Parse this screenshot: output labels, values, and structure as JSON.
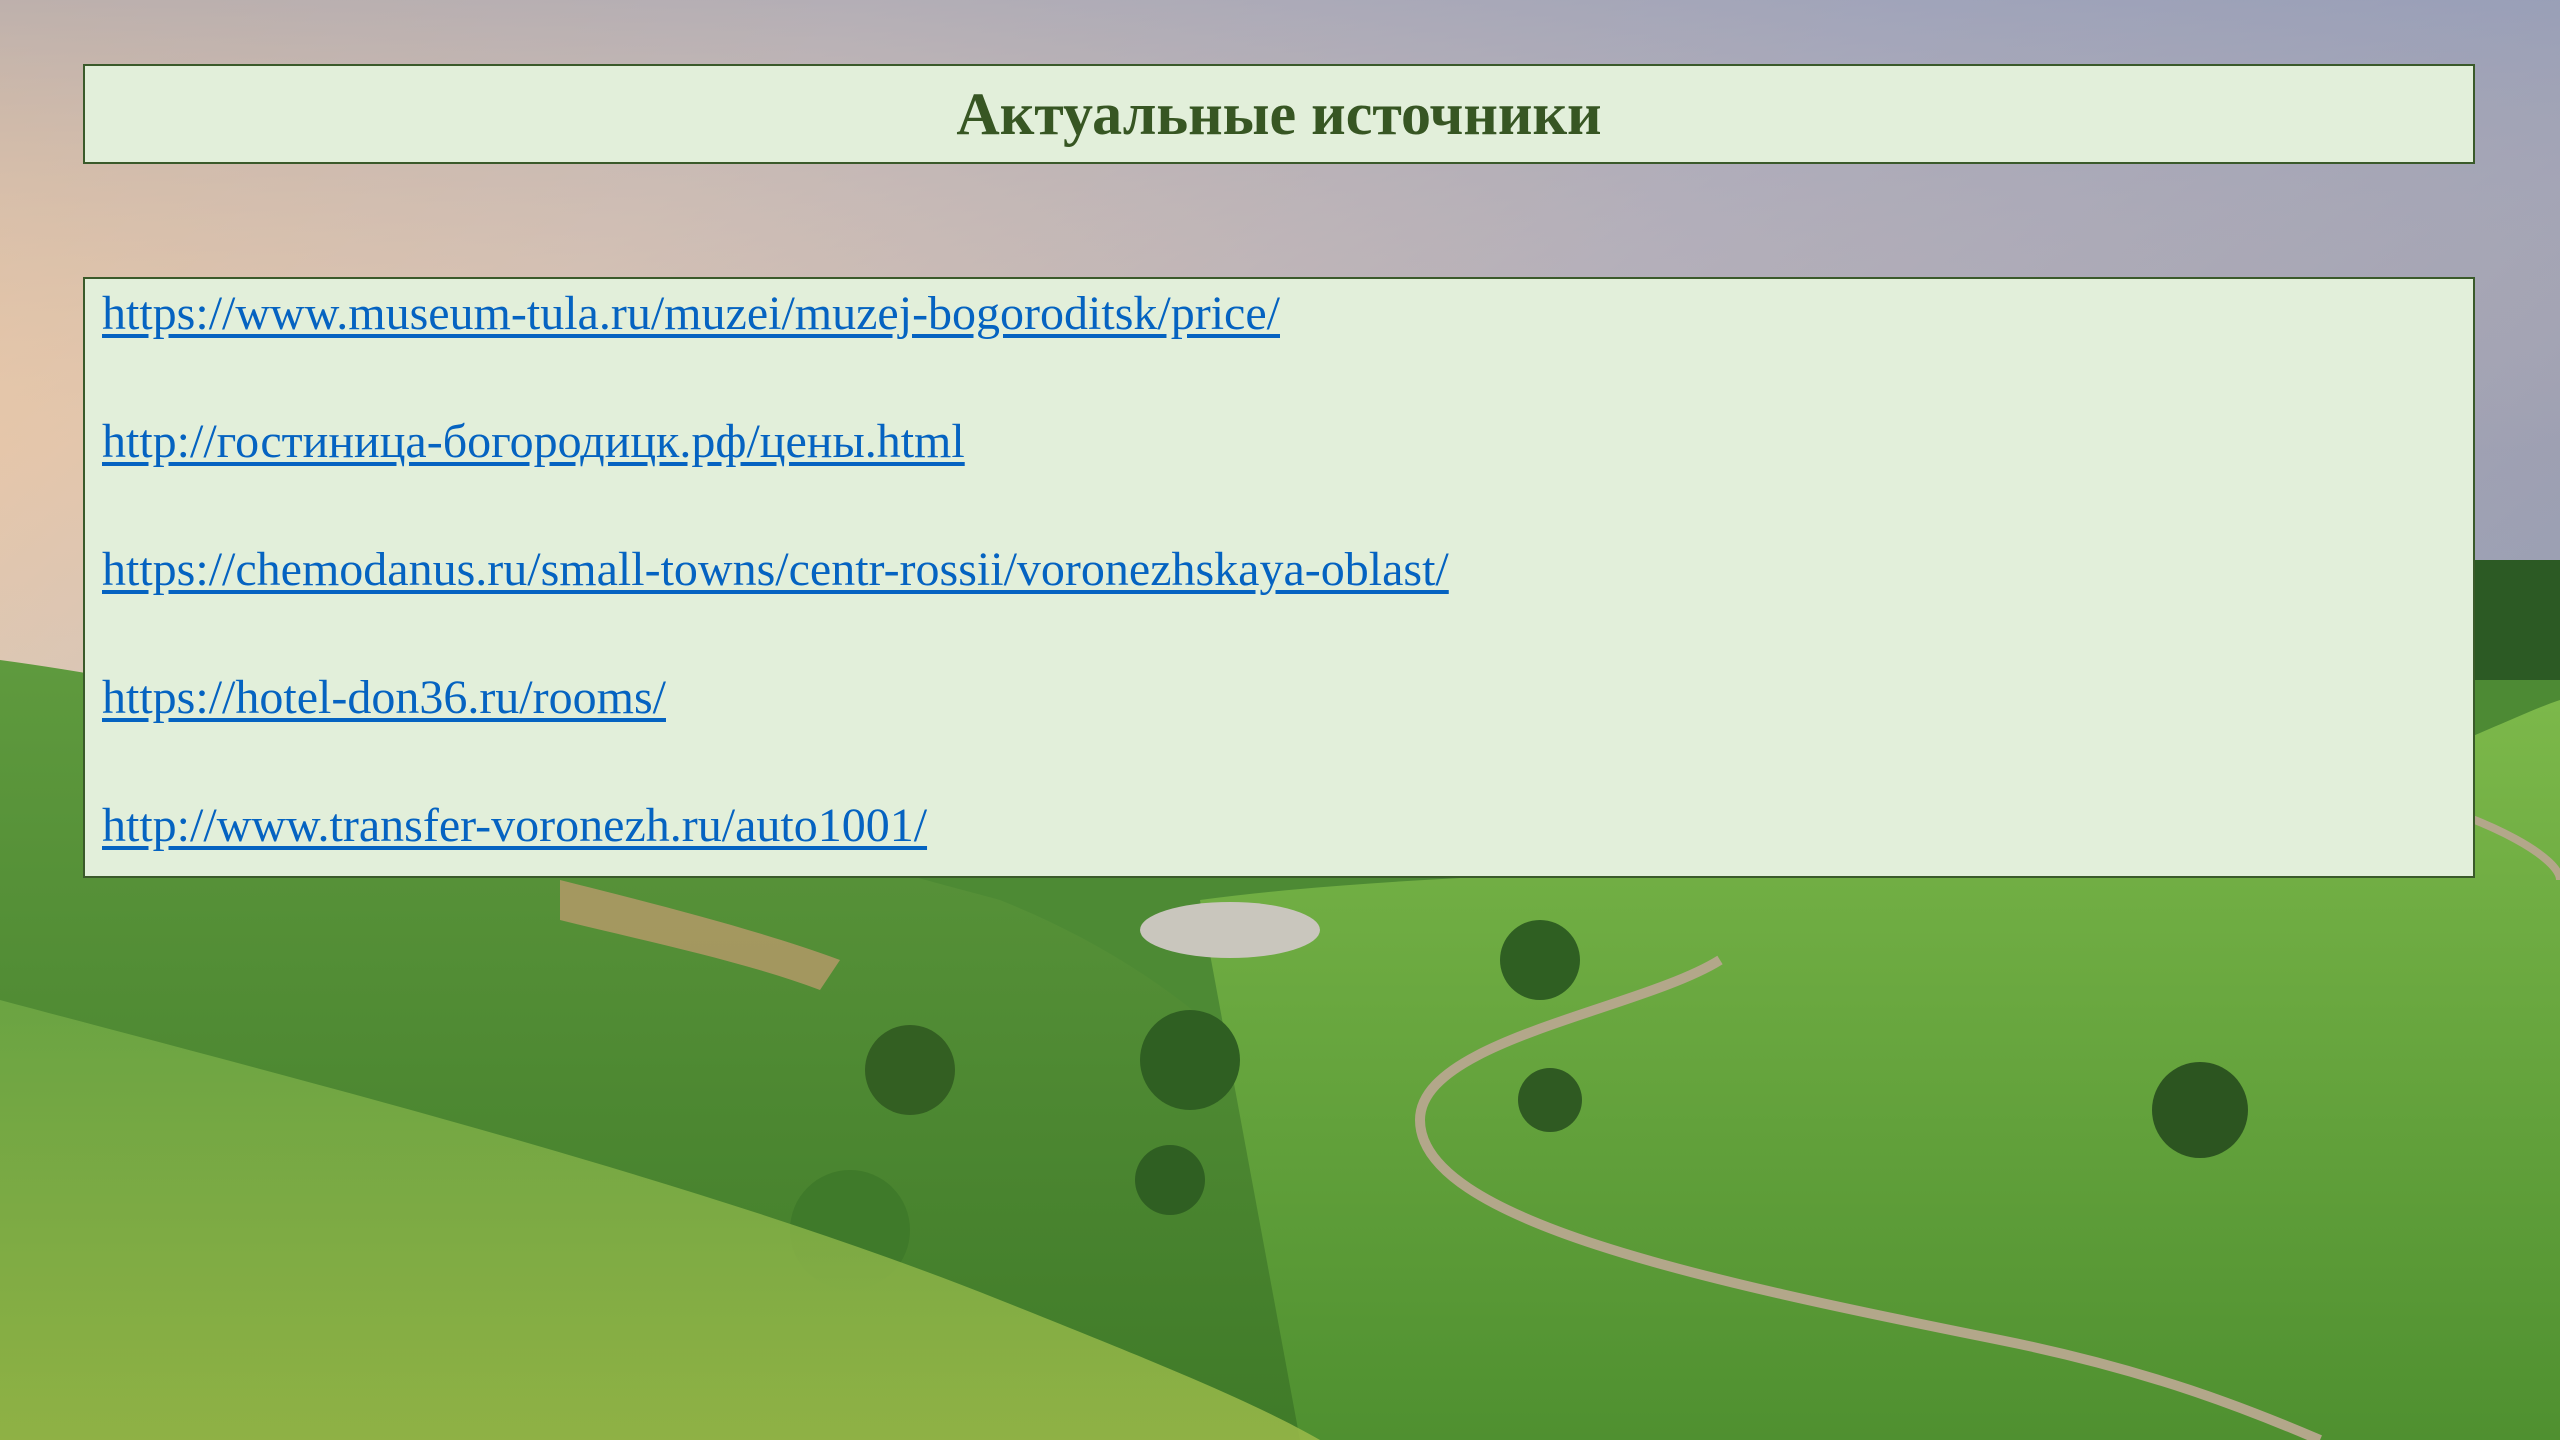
{
  "slide": {
    "title": "Актуальные источники",
    "links": [
      "https://www.museum-tula.ru/muzei/muzej-bogoroditsk/price/",
      "http://гостиница-богородицк.рф/цены.html",
      "https://chemodanus.ru/small-towns/centr-rossii/voronezhskaya-oblast/",
      "https://hotel-don36.ru/rooms/",
      "http://www.transfer-voronezh.ru/auto1001/"
    ]
  },
  "colors": {
    "box_fill": "#e2efda",
    "box_border": "#3a5a2a",
    "title": "#375623",
    "link": "#0563c1"
  }
}
